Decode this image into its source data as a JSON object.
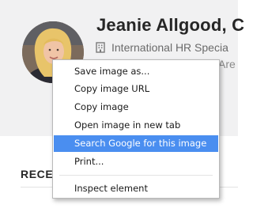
{
  "profile": {
    "name": "Jeanie Allgood, C",
    "title": "International HR Specia",
    "location": "Are"
  },
  "section": {
    "heading": "RECE"
  },
  "context_menu": {
    "items": [
      {
        "label": "Save image as..."
      },
      {
        "label": "Copy image URL"
      },
      {
        "label": "Copy image"
      },
      {
        "label": "Open image in new tab"
      },
      {
        "label": "Search Google for this image",
        "highlighted": true
      },
      {
        "label": "Print..."
      },
      {
        "label": "Inspect element"
      }
    ]
  },
  "icons": {
    "title_icon": "building-icon"
  },
  "colors": {
    "menu_highlight": "#4a8ef0",
    "header_background": "#f1f1f2"
  }
}
